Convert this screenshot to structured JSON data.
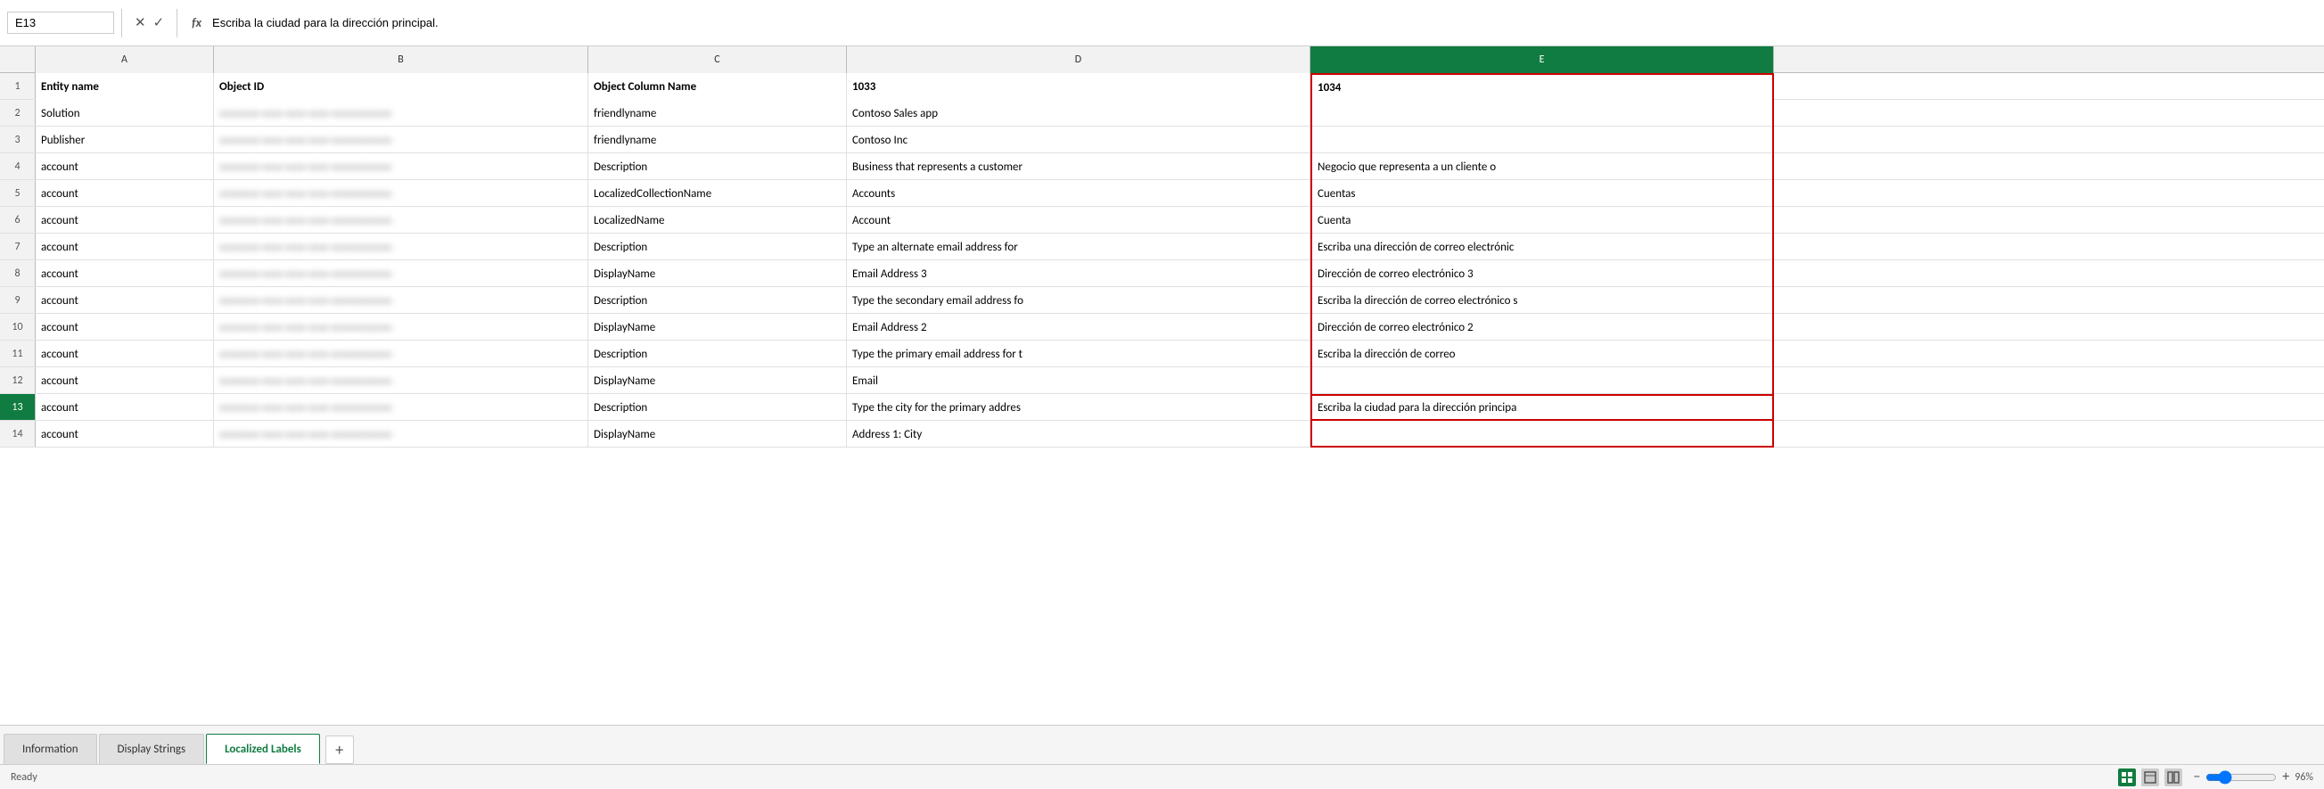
{
  "formulaBar": {
    "cellRef": "E13",
    "cancelIcon": "✕",
    "confirmIcon": "✓",
    "fxLabel": "fx",
    "formula": "Escriba la ciudad para la dirección principal."
  },
  "columns": [
    {
      "id": "row-num",
      "label": "",
      "class": "row-num-header"
    },
    {
      "id": "A",
      "label": "A",
      "class": "col-a"
    },
    {
      "id": "B",
      "label": "B",
      "class": "col-b"
    },
    {
      "id": "C",
      "label": "C",
      "class": "col-c"
    },
    {
      "id": "D",
      "label": "D",
      "class": "col-d"
    },
    {
      "id": "E",
      "label": "E",
      "class": "col-e"
    }
  ],
  "rows": [
    {
      "num": "1",
      "isHeader": true,
      "cells": [
        {
          "col": "A",
          "value": "Entity name",
          "bold": true
        },
        {
          "col": "B",
          "value": "Object ID",
          "bold": true,
          "blurred": false
        },
        {
          "col": "C",
          "value": "Object Column Name",
          "bold": true
        },
        {
          "col": "D",
          "value": "1033",
          "bold": true
        },
        {
          "col": "E",
          "value": "1034",
          "bold": true
        }
      ]
    },
    {
      "num": "2",
      "cells": [
        {
          "col": "A",
          "value": "Solution"
        },
        {
          "col": "B",
          "value": "xxxxxxxx-xxxx-xxxx-xxxx-xxxxxxxxxxxx",
          "blurred": true
        },
        {
          "col": "C",
          "value": "friendlyname"
        },
        {
          "col": "D",
          "value": "Contoso Sales app"
        },
        {
          "col": "E",
          "value": ""
        }
      ]
    },
    {
      "num": "3",
      "cells": [
        {
          "col": "A",
          "value": "Publisher"
        },
        {
          "col": "B",
          "value": "xxxxxxxx-xxxx-xxxx-xxxx-xxxxxxxxxxxx",
          "blurred": true
        },
        {
          "col": "C",
          "value": "friendlyname"
        },
        {
          "col": "D",
          "value": "Contoso Inc"
        },
        {
          "col": "E",
          "value": ""
        }
      ]
    },
    {
      "num": "4",
      "cells": [
        {
          "col": "A",
          "value": "account"
        },
        {
          "col": "B",
          "value": "xxxxxxxx-xxxx-xxxx-xxxx-xxxxxxxxxxxx",
          "blurred": true
        },
        {
          "col": "C",
          "value": "Description"
        },
        {
          "col": "D",
          "value": "Business that represents a customer"
        },
        {
          "col": "E",
          "value": "Negocio que representa a un cliente o"
        }
      ]
    },
    {
      "num": "5",
      "cells": [
        {
          "col": "A",
          "value": "account"
        },
        {
          "col": "B",
          "value": "xxxxxxxx-xxxx-xxxx-xxxx-xxxxxxxxxxxx",
          "blurred": true
        },
        {
          "col": "C",
          "value": "LocalizedCollectionName"
        },
        {
          "col": "D",
          "value": "Accounts"
        },
        {
          "col": "E",
          "value": "Cuentas"
        }
      ]
    },
    {
      "num": "6",
      "cells": [
        {
          "col": "A",
          "value": "account"
        },
        {
          "col": "B",
          "value": "xxxxxxxx-xxxx-xxxx-xxxx-xxxxxxxxxxxx",
          "blurred": true
        },
        {
          "col": "C",
          "value": "LocalizedName"
        },
        {
          "col": "D",
          "value": "Account"
        },
        {
          "col": "E",
          "value": "Cuenta"
        }
      ]
    },
    {
      "num": "7",
      "cells": [
        {
          "col": "A",
          "value": "account"
        },
        {
          "col": "B",
          "value": "xxxxxxxx-xxxx-xxxx-xxxx-xxxxxxxxxxxx",
          "blurred": true
        },
        {
          "col": "C",
          "value": "Description"
        },
        {
          "col": "D",
          "value": "Type an alternate email address for"
        },
        {
          "col": "E",
          "value": "Escriba una dirección de correo electrónic"
        }
      ]
    },
    {
      "num": "8",
      "cells": [
        {
          "col": "A",
          "value": "account"
        },
        {
          "col": "B",
          "value": "xxxxxxxx-xxxx-xxxx-xxxx-xxxxxxxxxxxx",
          "blurred": true
        },
        {
          "col": "C",
          "value": "DisplayName"
        },
        {
          "col": "D",
          "value": "Email Address 3"
        },
        {
          "col": "E",
          "value": "Dirección de correo electrónico 3"
        }
      ]
    },
    {
      "num": "9",
      "cells": [
        {
          "col": "A",
          "value": "account"
        },
        {
          "col": "B",
          "value": "xxxxxxxx-xxxx-xxxx-xxxx-xxxxxxxxxxxx",
          "blurred": true
        },
        {
          "col": "C",
          "value": "Description"
        },
        {
          "col": "D",
          "value": "Type the secondary email address fo"
        },
        {
          "col": "E",
          "value": "Escriba la dirección de correo electrónico s"
        }
      ]
    },
    {
      "num": "10",
      "cells": [
        {
          "col": "A",
          "value": "account"
        },
        {
          "col": "B",
          "value": "xxxxxxxx-xxxx-xxxx-xxxx-xxxxxxxxxxxx",
          "blurred": true
        },
        {
          "col": "C",
          "value": "DisplayName"
        },
        {
          "col": "D",
          "value": "Email Address 2"
        },
        {
          "col": "E",
          "value": "Dirección de correo electrónico 2"
        }
      ]
    },
    {
      "num": "11",
      "cells": [
        {
          "col": "A",
          "value": "account"
        },
        {
          "col": "B",
          "value": "xxxxxxxx-xxxx-xxxx-xxxx-xxxxxxxxxxxx",
          "blurred": true
        },
        {
          "col": "C",
          "value": "Description"
        },
        {
          "col": "D",
          "value": "Type the primary email address for t"
        },
        {
          "col": "E",
          "value": "Escriba la dirección de correo"
        }
      ]
    },
    {
      "num": "12",
      "cells": [
        {
          "col": "A",
          "value": "account"
        },
        {
          "col": "B",
          "value": "xxxxxxxx-xxxx-xxxx-xxxx-xxxxxxxxxxxx",
          "blurred": true
        },
        {
          "col": "C",
          "value": "DisplayName"
        },
        {
          "col": "D",
          "value": "Email"
        },
        {
          "col": "E",
          "value": ""
        }
      ]
    },
    {
      "num": "13",
      "isActive": true,
      "cells": [
        {
          "col": "A",
          "value": "account"
        },
        {
          "col": "B",
          "value": "xxxxxxxx-xxxx-xxxx-xxxx-xxxxxxxxxxxx",
          "blurred": true
        },
        {
          "col": "C",
          "value": "Description"
        },
        {
          "col": "D",
          "value": "Type the city for the primary addres"
        },
        {
          "col": "E",
          "value": "Escriba la ciudad para la dirección principa",
          "isActiveCell": true
        }
      ]
    },
    {
      "num": "14",
      "cells": [
        {
          "col": "A",
          "value": "account"
        },
        {
          "col": "B",
          "value": "xxxxxxxx-xxxx-xxxx-xxxx-xxxxxxxxxxxx",
          "blurred": true
        },
        {
          "col": "C",
          "value": "DisplayName"
        },
        {
          "col": "D",
          "value": "Address 1: City"
        },
        {
          "col": "E",
          "value": ""
        }
      ]
    }
  ],
  "tabs": [
    {
      "id": "information",
      "label": "Information",
      "active": false
    },
    {
      "id": "display-strings",
      "label": "Display Strings",
      "active": false
    },
    {
      "id": "localized-labels",
      "label": "Localized Labels",
      "active": true
    }
  ],
  "tabAddIcon": "+",
  "statusBar": {
    "ready": "Ready",
    "zoomLevel": "96%",
    "zoomMinus": "−",
    "zoomPlus": "+"
  }
}
